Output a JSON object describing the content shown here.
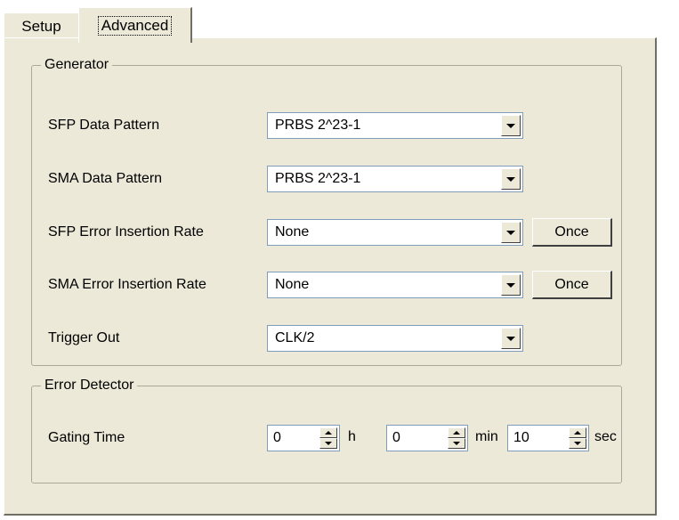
{
  "tabs": [
    {
      "label": "Setup",
      "active": false
    },
    {
      "label": "Advanced",
      "active": true
    }
  ],
  "generator": {
    "title": "Generator",
    "rows": [
      {
        "label": "SFP Data Pattern",
        "value": "PRBS 2^23-1"
      },
      {
        "label": "SMA Data Pattern",
        "value": "PRBS 2^23-1"
      },
      {
        "label": "SFP Error Insertion Rate",
        "value": "None",
        "button": "Once"
      },
      {
        "label": "SMA Error Insertion Rate",
        "value": "None",
        "button": "Once"
      },
      {
        "label": "Trigger Out",
        "value": "CLK/2"
      }
    ]
  },
  "error_detector": {
    "title": "Error Detector",
    "gating_label": "Gating Time",
    "hours": "0",
    "hours_unit": "h",
    "minutes": "0",
    "minutes_unit": "min",
    "seconds": "10",
    "seconds_unit": "sec"
  },
  "colors": {
    "panel_bg": "#ece9d8",
    "field_border": "#7f9db9",
    "group_border": "#aca899"
  }
}
